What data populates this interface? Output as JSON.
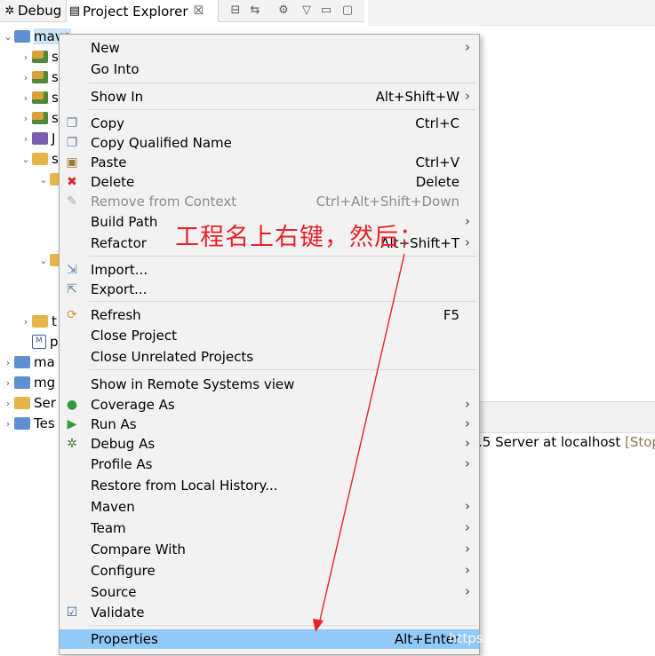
{
  "tabs": {
    "debug": {
      "label": "Debug",
      "icon": "bug-icon"
    },
    "project_explorer": {
      "label": "Project Explorer",
      "close": "☒"
    }
  },
  "tree": [
    {
      "label": "mave",
      "icon": "maven-project-icon",
      "twisty": "expanded",
      "selected": true
    },
    {
      "label": "s",
      "icon": "source-folder-icon",
      "twisty": "collapsed"
    },
    {
      "label": "s",
      "icon": "source-folder-icon",
      "twisty": "collapsed"
    },
    {
      "label": "s",
      "icon": "source-folder-icon",
      "twisty": "collapsed"
    },
    {
      "label": "s",
      "icon": "source-folder-icon",
      "twisty": "collapsed"
    },
    {
      "label": "J",
      "icon": "library-icon",
      "twisty": "collapsed"
    },
    {
      "label": "s",
      "icon": "folder-icon",
      "twisty": "expanded"
    },
    {
      "label": "",
      "icon": "folder-icon",
      "twisty": "expanded"
    },
    {
      "label": "",
      "icon": "folder-icon",
      "twisty": "expanded"
    },
    {
      "label": "t",
      "icon": "folder-icon",
      "twisty": "collapsed"
    },
    {
      "label": "p",
      "icon": "maven-file-icon",
      "twisty": ""
    },
    {
      "label": "ma",
      "icon": "maven-project-icon",
      "twisty": "collapsed"
    },
    {
      "label": "mg",
      "icon": "maven-project-icon",
      "twisty": "collapsed"
    },
    {
      "label": "Ser",
      "icon": "folder-icon",
      "twisty": "collapsed"
    },
    {
      "label": "Tes",
      "icon": "maven-project-icon",
      "twisty": "collapsed"
    }
  ],
  "console": {
    "text": ".5 Server at localhost",
    "status": "[Stop"
  },
  "menu": {
    "items": [
      {
        "label": "New",
        "accel": "",
        "submenu": true,
        "icon": ""
      },
      {
        "label": "Go Into",
        "accel": "",
        "submenu": false,
        "icon": ""
      },
      {
        "label": "Show In",
        "accel": "Alt+Shift+W",
        "submenu": true,
        "icon": ""
      },
      {
        "label": "Copy",
        "accel": "Ctrl+C",
        "submenu": false,
        "icon": "copy-icon"
      },
      {
        "label": "Copy Qualified Name",
        "accel": "",
        "submenu": false,
        "icon": "copy-qualified-icon"
      },
      {
        "label": "Paste",
        "accel": "Ctrl+V",
        "submenu": false,
        "icon": "paste-icon"
      },
      {
        "label": "Delete",
        "accel": "Delete",
        "submenu": false,
        "icon": "delete-icon"
      },
      {
        "label": "Remove from Context",
        "accel": "Ctrl+Alt+Shift+Down",
        "submenu": false,
        "icon": "remove-context-icon",
        "disabled": true
      },
      {
        "label": "Build Path",
        "accel": "",
        "submenu": true,
        "icon": ""
      },
      {
        "label": "Refactor",
        "accel": "Alt+Shift+T",
        "submenu": true,
        "icon": ""
      },
      {
        "label": "Import...",
        "accel": "",
        "submenu": false,
        "icon": "import-icon"
      },
      {
        "label": "Export...",
        "accel": "",
        "submenu": false,
        "icon": "export-icon"
      },
      {
        "label": "Refresh",
        "accel": "F5",
        "submenu": false,
        "icon": "refresh-icon"
      },
      {
        "label": "Close Project",
        "accel": "",
        "submenu": false,
        "icon": ""
      },
      {
        "label": "Close Unrelated Projects",
        "accel": "",
        "submenu": false,
        "icon": ""
      },
      {
        "label": "Show in Remote Systems view",
        "accel": "",
        "submenu": false,
        "icon": ""
      },
      {
        "label": "Coverage As",
        "accel": "",
        "submenu": true,
        "icon": "coverage-icon"
      },
      {
        "label": "Run As",
        "accel": "",
        "submenu": true,
        "icon": "run-icon"
      },
      {
        "label": "Debug As",
        "accel": "",
        "submenu": true,
        "icon": "debug-icon"
      },
      {
        "label": "Profile As",
        "accel": "",
        "submenu": true,
        "icon": ""
      },
      {
        "label": "Restore from Local History...",
        "accel": "",
        "submenu": false,
        "icon": ""
      },
      {
        "label": "Maven",
        "accel": "",
        "submenu": true,
        "icon": ""
      },
      {
        "label": "Team",
        "accel": "",
        "submenu": true,
        "icon": ""
      },
      {
        "label": "Compare With",
        "accel": "",
        "submenu": true,
        "icon": ""
      },
      {
        "label": "Configure",
        "accel": "",
        "submenu": true,
        "icon": ""
      },
      {
        "label": "Source",
        "accel": "",
        "submenu": true,
        "icon": ""
      },
      {
        "label": "Validate",
        "accel": "",
        "submenu": false,
        "icon": "checkbox-checked-icon"
      },
      {
        "label": "Properties",
        "accel": "Alt+Enter",
        "submenu": false,
        "icon": "",
        "highlighted": true
      }
    ]
  },
  "annotation": {
    "text": "工程名上右键，然后：",
    "color": "#e8222a"
  },
  "watermark": "https://blog.csdn.net/csucsgoat",
  "colors": {
    "highlight": "#91c9f7",
    "menu_bg": "#f2f2f2",
    "annotation": "#e8222a"
  }
}
